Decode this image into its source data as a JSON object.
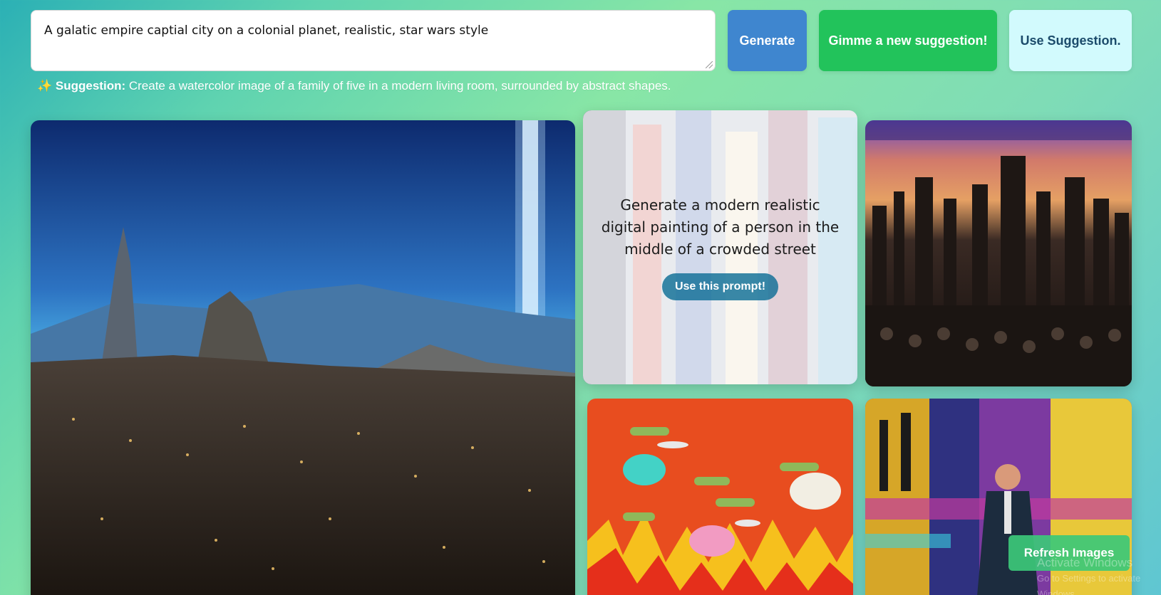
{
  "prompt": {
    "value": "A galatic empire captial city on a colonial planet, realistic, star wars style"
  },
  "buttons": {
    "generate": "Generate",
    "new_suggestion": "Gimme a new suggestion!",
    "use_suggestion": "Use Suggestion."
  },
  "suggestion": {
    "icon": "sparkles-icon",
    "label": "Suggestion:",
    "text": "Create a watercolor image of a family of five in a modern living room, surrounded by abstract shapes."
  },
  "gallery": {
    "hover_card": {
      "prompt": "Generate a modern realistic digital painting of a person in the middle of a crowded street",
      "button": "Use this prompt!"
    },
    "images": [
      "galactic-city-image",
      "crowded-street-painting-image",
      "dark-city-skyline-image",
      "cartoon-drones-fire-image",
      "colorful-man-painting-image"
    ]
  },
  "refresh_button": "Refresh Images",
  "watermark": {
    "title": "Activate Windows",
    "sub": "Go to Settings to activate Windows."
  },
  "colors": {
    "generate": "#3f86cf",
    "new_suggestion": "#22c35b",
    "use_suggestion": "#d2fafd",
    "refresh": "#3cc878"
  }
}
